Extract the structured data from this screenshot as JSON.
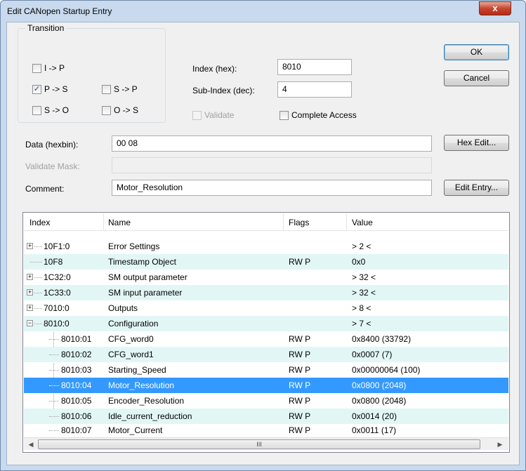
{
  "window": {
    "title": "Edit CANopen Startup Entry",
    "close_glyph": "x"
  },
  "transition": {
    "label": "Transition",
    "options": [
      {
        "label": "I -> P",
        "checked": false
      },
      {
        "label": "P -> S",
        "checked": true
      },
      {
        "label": "S -> P",
        "checked": false
      },
      {
        "label": "S -> O",
        "checked": false
      },
      {
        "label": "O -> S",
        "checked": false
      }
    ]
  },
  "fields": {
    "index_label": "Index (hex):",
    "index_value": "8010",
    "subindex_label": "Sub-Index (dec):",
    "subindex_value": "4",
    "validate_label": "Validate",
    "complete_access_label": "Complete Access",
    "data_label": "Data (hexbin):",
    "data_value": "00 08",
    "validate_mask_label": "Validate Mask:",
    "validate_mask_value": "",
    "comment_label": "Comment:",
    "comment_value": "Motor_Resolution"
  },
  "buttons": {
    "ok": "OK",
    "cancel": "Cancel",
    "hex_edit": "Hex Edit...",
    "edit_entry": "Edit Entry..."
  },
  "list": {
    "columns": [
      "Index",
      "Name",
      "Flags",
      "Value"
    ],
    "rows": [
      {
        "index": "10F1:0",
        "name": "Error Settings",
        "flags": "",
        "value": "> 2 <",
        "expander": "+"
      },
      {
        "index": "10F8",
        "name": "Timestamp Object",
        "flags": "RW P",
        "value": "0x0",
        "expander": ""
      },
      {
        "index": "1C32:0",
        "name": "SM output parameter",
        "flags": "",
        "value": "> 32 <",
        "expander": "+"
      },
      {
        "index": "1C33:0",
        "name": "SM input parameter",
        "flags": "",
        "value": "> 32 <",
        "expander": "+"
      },
      {
        "index": "7010:0",
        "name": "Outputs",
        "flags": "",
        "value": "> 8 <",
        "expander": "+"
      },
      {
        "index": "8010:0",
        "name": "Configuration",
        "flags": "",
        "value": "> 7 <",
        "expander": "−"
      },
      {
        "index": "8010:01",
        "name": "CFG_word0",
        "flags": "RW P",
        "value": "0x8400 (33792)",
        "expander": ""
      },
      {
        "index": "8010:02",
        "name": "CFG_word1",
        "flags": "RW P",
        "value": "0x0007 (7)",
        "expander": ""
      },
      {
        "index": "8010:03",
        "name": "Starting_Speed",
        "flags": "RW P",
        "value": "0x00000064 (100)",
        "expander": ""
      },
      {
        "index": "8010:04",
        "name": "Motor_Resolution",
        "flags": "RW P",
        "value": "0x0800 (2048)",
        "expander": ""
      },
      {
        "index": "8010:05",
        "name": "Encoder_Resolution",
        "flags": "RW P",
        "value": "0x0800 (2048)",
        "expander": ""
      },
      {
        "index": "8010:06",
        "name": "Idle_current_reduction",
        "flags": "RW P",
        "value": "0x0014 (20)",
        "expander": ""
      },
      {
        "index": "8010:07",
        "name": "Motor_Current",
        "flags": "RW P",
        "value": "0x0011 (17)",
        "expander": ""
      }
    ],
    "selected_index": "8010:04"
  },
  "scrollbar": {
    "left_arrow": "◀",
    "right_arrow": "▶",
    "grip": "III"
  },
  "colors": {
    "selection": "#3399ff",
    "alt_row": "#e2f6f6",
    "title_bg": "#c9daee",
    "close": "#c7452f"
  }
}
